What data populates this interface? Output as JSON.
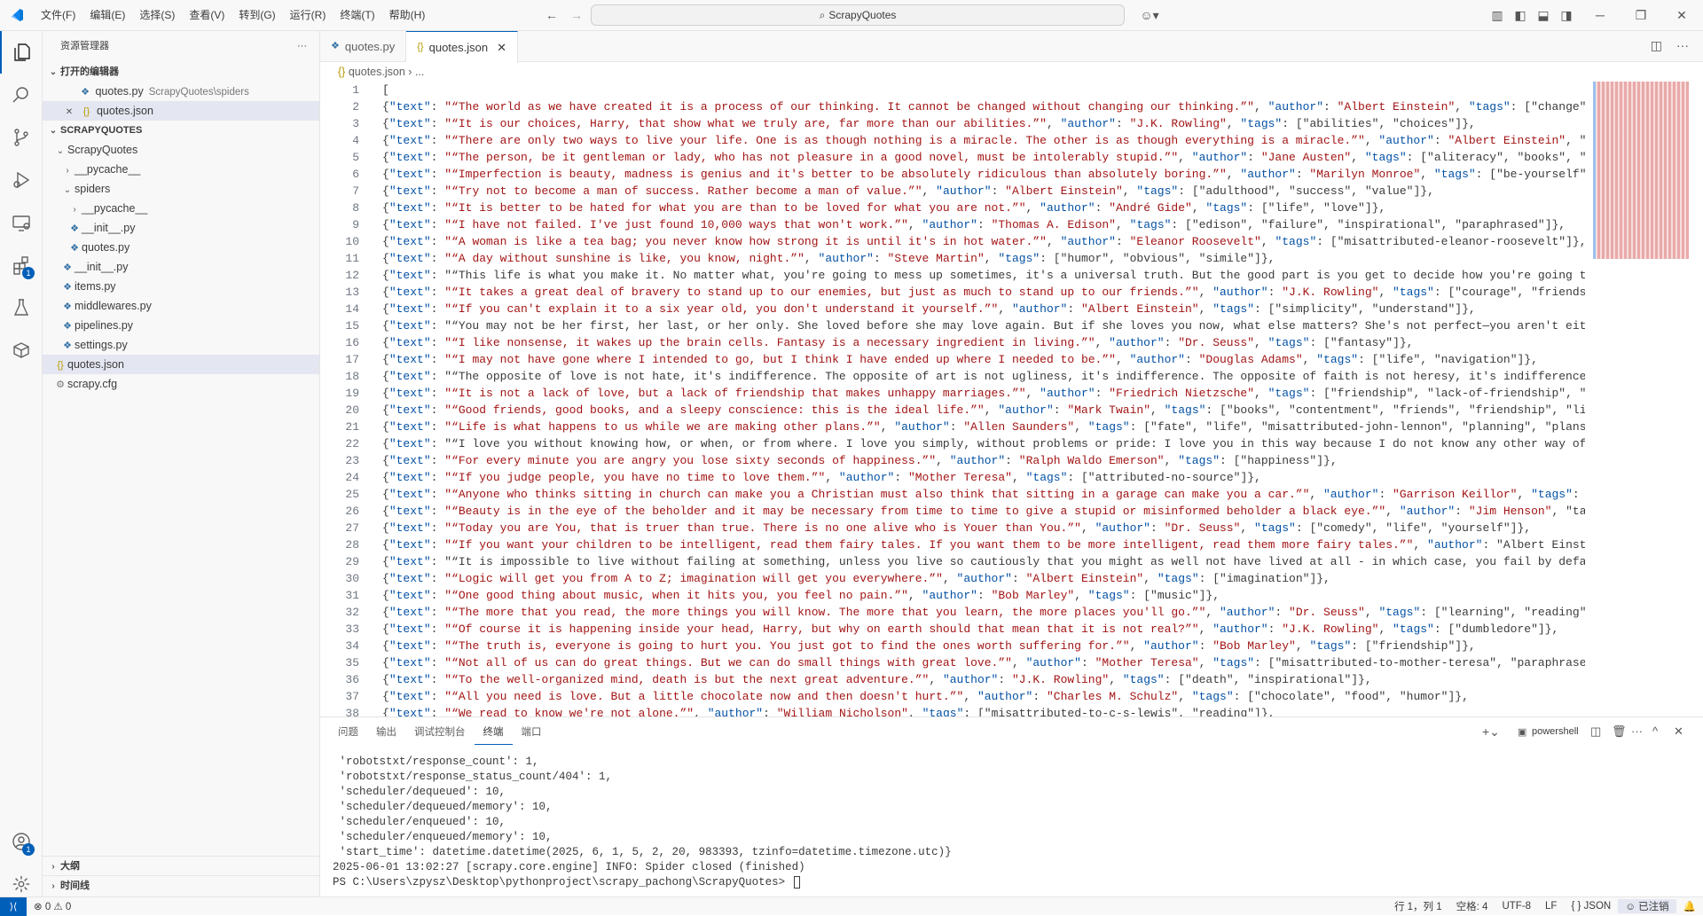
{
  "title_bar": {
    "menus": [
      "文件(F)",
      "编辑(E)",
      "选择(S)",
      "查看(V)",
      "转到(G)",
      "运行(R)",
      "终端(T)",
      "帮助(H)"
    ],
    "search_text": "ScrapyQuotes"
  },
  "activity_bar": {
    "extensions_badge": "1",
    "accounts_badge": "1"
  },
  "sidebar": {
    "title": "资源管理器",
    "open_editors_label": "打开的编辑器",
    "open_editors": [
      {
        "name": "quotes.py",
        "desc": "ScrapyQuotes\\spiders"
      },
      {
        "name": "quotes.json",
        "desc": ""
      }
    ],
    "project_label": "SCRAPYQUOTES",
    "tree": [
      {
        "name": "ScrapyQuotes",
        "type": "folder-open"
      },
      {
        "name": "__pycache__",
        "type": "folder"
      },
      {
        "name": "spiders",
        "type": "folder-open"
      },
      {
        "name": "__pycache__",
        "type": "folder"
      },
      {
        "name": "__init__.py",
        "type": "py"
      },
      {
        "name": "quotes.py",
        "type": "py"
      },
      {
        "name": "__init__.py",
        "type": "py"
      },
      {
        "name": "items.py",
        "type": "py"
      },
      {
        "name": "middlewares.py",
        "type": "py"
      },
      {
        "name": "pipelines.py",
        "type": "py"
      },
      {
        "name": "settings.py",
        "type": "py"
      },
      {
        "name": "quotes.json",
        "type": "json"
      },
      {
        "name": "scrapy.cfg",
        "type": "cfg"
      }
    ],
    "outline_label": "大纲",
    "timeline_label": "时间线"
  },
  "tabs": [
    {
      "label": "quotes.py",
      "active": false
    },
    {
      "label": "quotes.json",
      "active": true
    }
  ],
  "breadcrumb": {
    "file": "quotes.json",
    "rest": "..."
  },
  "editor": {
    "lines": [
      "[",
      "{\"text\": \"“The world as we have created it is a process of our thinking. It cannot be changed without changing our thinking.”\", \"author\": \"Albert Einstein\", \"tags\": [\"change\",",
      "{\"text\": \"“It is our choices, Harry, that show what we truly are, far more than our abilities.”\", \"author\": \"J.K. Rowling\", \"tags\": [\"abilities\", \"choices\"]},",
      "{\"text\": \"“There are only two ways to live your life. One is as though nothing is a miracle. The other is as though everything is a miracle.”\", \"author\": \"Albert Einstein\", \"ta",
      "{\"text\": \"“The person, be it gentleman or lady, who has not pleasure in a good novel, must be intolerably stupid.”\", \"author\": \"Jane Austen\", \"tags\": [\"aliteracy\", \"books\", \"cl",
      "{\"text\": \"“Imperfection is beauty, madness is genius and it's better to be absolutely ridiculous than absolutely boring.”\", \"author\": \"Marilyn Monroe\", \"tags\": [\"be-yourself\",",
      "{\"text\": \"“Try not to become a man of success. Rather become a man of value.”\", \"author\": \"Albert Einstein\", \"tags\": [\"adulthood\", \"success\", \"value\"]},",
      "{\"text\": \"“It is better to be hated for what you are than to be loved for what you are not.”\", \"author\": \"André Gide\", \"tags\": [\"life\", \"love\"]},",
      "{\"text\": \"“I have not failed. I've just found 10,000 ways that won't work.”\", \"author\": \"Thomas A. Edison\", \"tags\": [\"edison\", \"failure\", \"inspirational\", \"paraphrased\"]},",
      "{\"text\": \"“A woman is like a tea bag; you never know how strong it is until it's in hot water.”\", \"author\": \"Eleanor Roosevelt\", \"tags\": [\"misattributed-eleanor-roosevelt\"]},",
      "{\"text\": \"“A day without sunshine is like, you know, night.”\", \"author\": \"Steve Martin\", \"tags\": [\"humor\", \"obvious\", \"simile\"]},",
      "{\"text\": \"“This life is what you make it. No matter what, you're going to mess up sometimes, it's a universal truth. But the good part is you get to decide how you're going to m",
      "{\"text\": \"“It takes a great deal of bravery to stand up to our enemies, but just as much to stand up to our friends.”\", \"author\": \"J.K. Rowling\", \"tags\": [\"courage\", \"friends\"]",
      "{\"text\": \"“If you can't explain it to a six year old, you don't understand it yourself.”\", \"author\": \"Albert Einstein\", \"tags\": [\"simplicity\", \"understand\"]},",
      "{\"text\": \"“You may not be her first, her last, or her only. She loved before she may love again. But if she loves you now, what else matters? She's not perfect—you aren't eithe",
      "{\"text\": \"“I like nonsense, it wakes up the brain cells. Fantasy is a necessary ingredient in living.”\", \"author\": \"Dr. Seuss\", \"tags\": [\"fantasy\"]},",
      "{\"text\": \"“I may not have gone where I intended to go, but I think I have ended up where I needed to be.”\", \"author\": \"Douglas Adams\", \"tags\": [\"life\", \"navigation\"]},",
      "{\"text\": \"“The opposite of love is not hate, it's indifference. The opposite of art is not ugliness, it's indifference. The opposite of faith is not heresy, it's indifference. A",
      "{\"text\": \"“It is not a lack of love, but a lack of friendship that makes unhappy marriages.”\", \"author\": \"Friedrich Nietzsche\", \"tags\": [\"friendship\", \"lack-of-friendship\", \"la",
      "{\"text\": \"“Good friends, good books, and a sleepy conscience: this is the ideal life.”\", \"author\": \"Mark Twain\", \"tags\": [\"books\", \"contentment\", \"friends\", \"friendship\", \"life",
      "{\"text\": \"“Life is what happens to us while we are making other plans.”\", \"author\": \"Allen Saunders\", \"tags\": [\"fate\", \"life\", \"misattributed-john-lennon\", \"planning\", \"plans\"]",
      "{\"text\": \"“I love you without knowing how, or when, or from where. I love you simply, without problems or pride: I love you in this way because I do not know any other way of l",
      "{\"text\": \"“For every minute you are angry you lose sixty seconds of happiness.”\", \"author\": \"Ralph Waldo Emerson\", \"tags\": [\"happiness\"]},",
      "{\"text\": \"“If you judge people, you have no time to love them.”\", \"author\": \"Mother Teresa\", \"tags\": [\"attributed-no-source\"]},",
      "{\"text\": \"“Anyone who thinks sitting in church can make you a Christian must also think that sitting in a garage can make you a car.”\", \"author\": \"Garrison Keillor\", \"tags\": [\"",
      "{\"text\": \"“Beauty is in the eye of the beholder and it may be necessary from time to time to give a stupid or misinformed beholder a black eye.”\", \"author\": \"Jim Henson\", \"tags",
      "{\"text\": \"“Today you are You, that is truer than true. There is no one alive who is Youer than You.”\", \"author\": \"Dr. Seuss\", \"tags\": [\"comedy\", \"life\", \"yourself\"]},",
      "{\"text\": \"“If you want your children to be intelligent, read them fairy tales. If you want them to be more intelligent, read them more fairy tales.”\", \"author\": \"Albert Einstei",
      "{\"text\": \"“It is impossible to live without failing at something, unless you live so cautiously that you might as well not have lived at all - in which case, you fail by defaul",
      "{\"text\": \"“Logic will get you from A to Z; imagination will get you everywhere.”\", \"author\": \"Albert Einstein\", \"tags\": [\"imagination\"]},",
      "{\"text\": \"“One good thing about music, when it hits you, you feel no pain.”\", \"author\": \"Bob Marley\", \"tags\": [\"music\"]},",
      "{\"text\": \"“The more that you read, the more things you will know. The more that you learn, the more places you'll go.”\", \"author\": \"Dr. Seuss\", \"tags\": [\"learning\", \"reading\",",
      "{\"text\": \"“Of course it is happening inside your head, Harry, but why on earth should that mean that it is not real?”\", \"author\": \"J.K. Rowling\", \"tags\": [\"dumbledore\"]},",
      "{\"text\": \"“The truth is, everyone is going to hurt you. You just got to find the ones worth suffering for.”\", \"author\": \"Bob Marley\", \"tags\": [\"friendship\"]},",
      "{\"text\": \"“Not all of us can do great things. But we can do small things with great love.”\", \"author\": \"Mother Teresa\", \"tags\": [\"misattributed-to-mother-teresa\", \"paraphrased\"",
      "{\"text\": \"“To the well-organized mind, death is but the next great adventure.”\", \"author\": \"J.K. Rowling\", \"tags\": [\"death\", \"inspirational\"]},",
      "{\"text\": \"“All you need is love. But a little chocolate now and then doesn't hurt.”\", \"author\": \"Charles M. Schulz\", \"tags\": [\"chocolate\", \"food\", \"humor\"]},",
      "{\"text\": \"“We read to know we're not alone.”\", \"author\": \"William Nicholson\", \"tags\": [\"misattributed-to-c-s-lewis\", \"reading\"]},"
    ]
  },
  "panel": {
    "tabs": [
      "问题",
      "输出",
      "调试控制台",
      "终端",
      "端口"
    ],
    "active_tab": "终端",
    "shell_label": "powershell",
    "terminal_lines": [
      " 'robotstxt/response_count': 1,",
      " 'robotstxt/response_status_count/404': 1,",
      " 'scheduler/dequeued': 10,",
      " 'scheduler/dequeued/memory': 10,",
      " 'scheduler/enqueued': 10,",
      " 'scheduler/enqueued/memory': 10,",
      " 'start_time': datetime.datetime(2025, 6, 1, 5, 2, 20, 983393, tzinfo=datetime.timezone.utc)}",
      "2025-06-01 13:02:27 [scrapy.core.engine] INFO: Spider closed (finished)",
      "PS C:\\Users\\zpysz\\Desktop\\pythonproject\\scrapy_pachong\\ScrapyQuotes> "
    ]
  },
  "status_bar": {
    "problems": "⊗ 0 ⚠ 0",
    "position": "行 1，列 1",
    "spaces": "空格: 4",
    "encoding": "UTF-8",
    "eol": "LF",
    "language": "JSON",
    "annotated": "已注销"
  }
}
